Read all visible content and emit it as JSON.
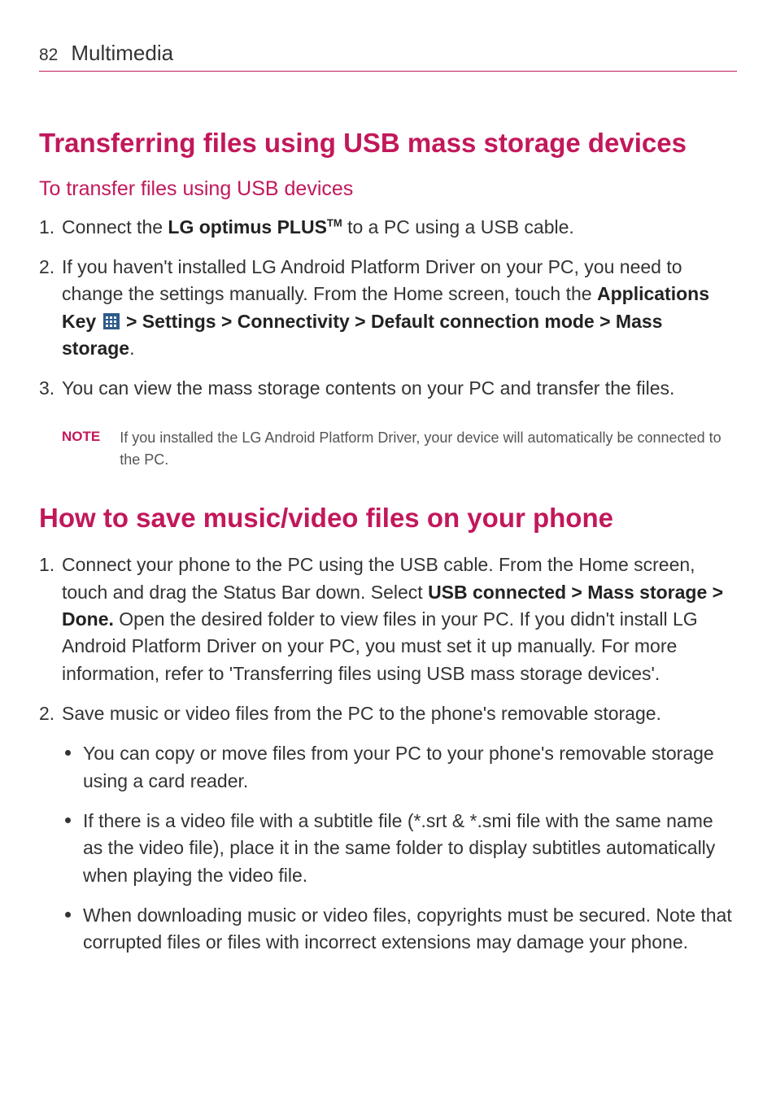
{
  "header": {
    "pageNumber": "82",
    "sectionTitle": "Multimedia"
  },
  "section1": {
    "title": "Transferring files using USB mass storage devices",
    "subtitle": "To transfer files using USB devices",
    "step1_a": "Connect the ",
    "step1_bold": "LG optimus PLUS",
    "step1_tm": "TM",
    "step1_b": " to a PC using a USB cable.",
    "step2_a": "If you haven't installed LG Android Platform Driver on your PC, you need to change the settings manually. From the Home screen, touch the ",
    "step2_bold_a": "Applications Key ",
    "step2_bold_b": " > Settings > Connectivity > Default connection mode > Mass storage",
    "step2_b": ".",
    "step3": "You can view the mass storage contents on your PC and transfer the files.",
    "noteLabel": "NOTE",
    "noteText": "If you installed the LG Android Platform Driver, your device will automatically be connected to the PC."
  },
  "section2": {
    "title": "How to save music/video files on your phone",
    "step1_a": "Connect your phone to the PC using the USB cable. From the Home screen, touch and drag the Status Bar down. Select ",
    "step1_bold": "USB connected > Mass storage > Done.",
    "step1_b": " Open the desired folder to view files in your PC. If you didn't install LG Android Platform Driver on your PC, you must set it up manually. For more information, refer to 'Transferring files using USB  mass storage devices'.",
    "step2": "Save music or video files from the PC to the phone's removable storage.",
    "bullet1": "You can copy or move files from your PC to your phone's removable storage using a card reader.",
    "bullet2": "If there is a video file with a subtitle file (*.srt & *.smi file with the same name as the video file), place it in the same folder to display subtitles automatically when playing the video file.",
    "bullet3": "When downloading music or video files, copyrights must be secured. Note that corrupted files or files with incorrect extensions may damage your phone."
  }
}
